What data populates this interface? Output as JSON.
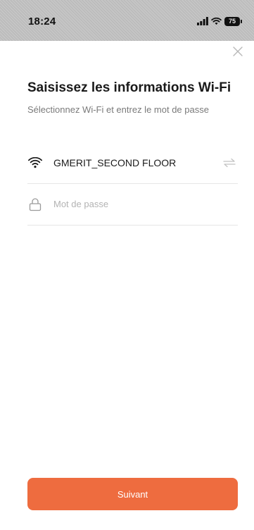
{
  "status_bar": {
    "time": "18:24",
    "battery": "75"
  },
  "header": {
    "title": "Saisissez les informations Wi-Fi",
    "subtitle": "Sélectionnez Wi-Fi et entrez le mot de passe"
  },
  "wifi": {
    "network_name": "GMERIT_SECOND FLOOR",
    "icon": "wifi-icon",
    "switch_icon": "swap-arrows-icon"
  },
  "password": {
    "placeholder": "Mot de passe",
    "value": "",
    "icon": "lock-icon"
  },
  "actions": {
    "next_label": "Suivant"
  },
  "colors": {
    "accent": "#ee6c3f",
    "status_bar": "#c2c2c2",
    "subtitle": "#7a7a7a",
    "placeholder": "#b3b3b3",
    "divider": "#e6e6e6"
  }
}
